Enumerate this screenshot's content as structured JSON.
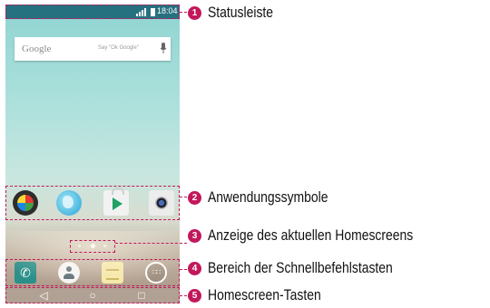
{
  "status_bar": {
    "time": "18:04"
  },
  "search_bar": {
    "logo": "Google",
    "hint": "Say \"Ok Google\"",
    "icon": "mic-icon"
  },
  "app_icons": [
    "gallery-icon",
    "internet-globe-icon",
    "play-store-icon",
    "camera-icon"
  ],
  "page_indicator": {
    "pages": 3,
    "active_index": 1
  },
  "quick_access": [
    "phone-icon",
    "contacts-icon",
    "messaging-icon",
    "apps-icon"
  ],
  "nav_buttons": {
    "back": "◁",
    "home": "○",
    "recent": "□"
  },
  "callouts": [
    {
      "number": "1",
      "label": "Statusleiste"
    },
    {
      "number": "2",
      "label": "Anwendungssymbole"
    },
    {
      "number": "3",
      "label": "Anzeige des aktuellen Homescreens"
    },
    {
      "number": "4",
      "label": "Bereich der Schnellbefehlstasten"
    },
    {
      "number": "5",
      "label": "Homescreen-Tasten"
    }
  ],
  "colors": {
    "callout_accent": "#c2185b",
    "status_bar": "#26717f",
    "wallpaper_top": "#8fd4d2",
    "nav_bar": "#b1a194"
  }
}
